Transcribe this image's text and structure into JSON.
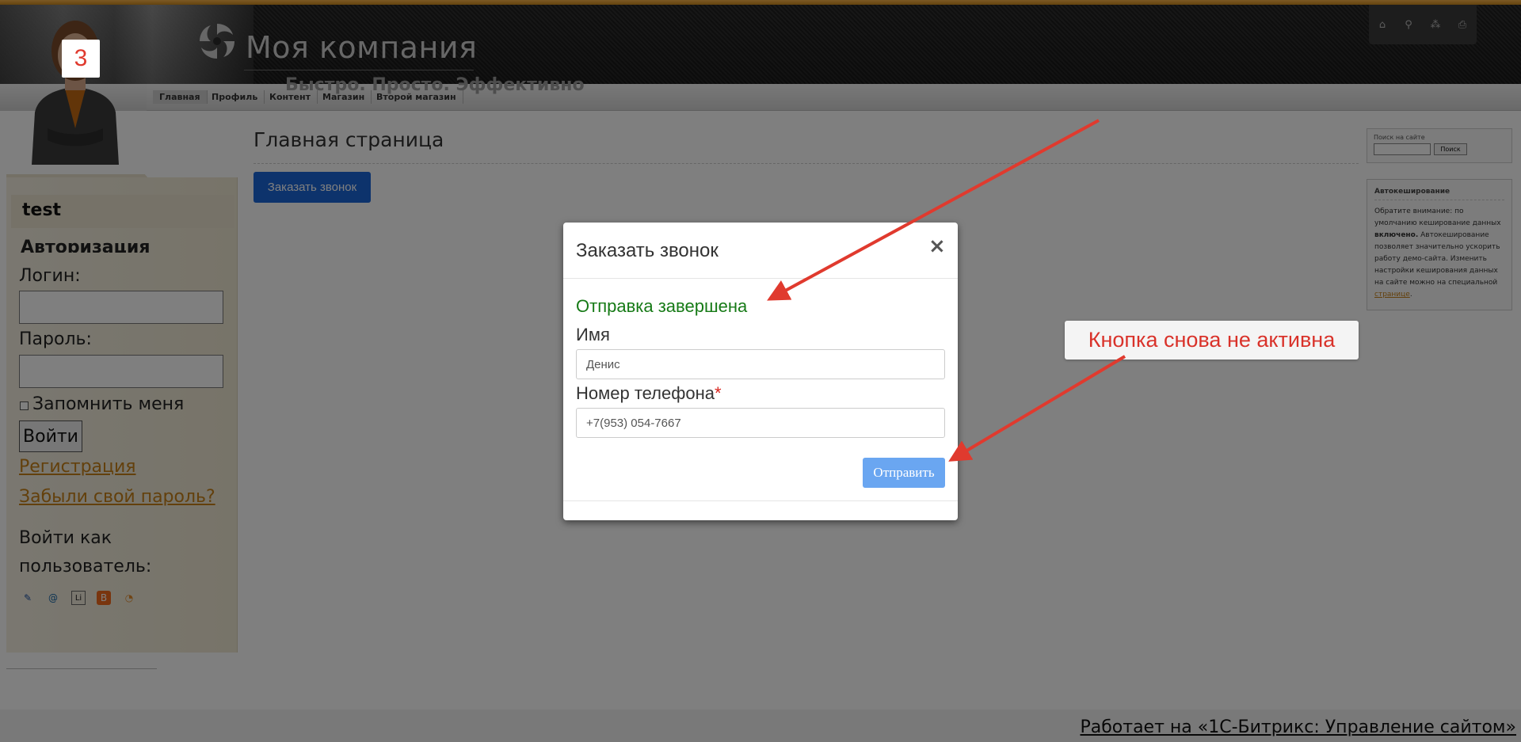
{
  "header": {
    "company_name": "Моя компания",
    "slogan": "Быстро. Просто. Эффективно",
    "icons": [
      "home-icon",
      "search-icon",
      "sitemap-icon",
      "print-icon"
    ]
  },
  "nav": {
    "items": [
      {
        "label": "Главная",
        "active": true
      },
      {
        "label": "Профиль"
      },
      {
        "label": "Контент"
      },
      {
        "label": "Магазин"
      },
      {
        "label": "Второй магазин"
      }
    ]
  },
  "main": {
    "page_title": "Главная страница",
    "order_call_button": "Заказать звонок"
  },
  "sidebar": {
    "test_label": "test",
    "auth_title": "Авторизация",
    "login_label": "Логин:",
    "password_label": "Пароль:",
    "remember_label": "Запомнить меня",
    "login_button": "Войти",
    "register_link": "Регистрация",
    "forgot_link": "Забыли свой пароль?",
    "login_as_label": "Войти как пользователь:",
    "social_icons": [
      "livejournal-icon",
      "mail-ru-icon",
      "liveinternet-icon",
      "blogger-icon",
      "openid-icon"
    ]
  },
  "right": {
    "search_label": "Поиск на сайте",
    "search_button": "Поиск",
    "cache_title": "Автокеширование",
    "cache_text_1": "Обратите внимание: по умолчанию кеширование данных",
    "cache_text_bold": "включено.",
    "cache_text_2": "Автокеширование позволяет значительно ускорить работу демо-сайта. Изменить настройки кеширования данных на сайте можно на специальной",
    "cache_link": "странице",
    "cache_text_end": "."
  },
  "footer": {
    "powered_by": "Работает на «1С-Битрикс: Управление сайтом»"
  },
  "modal": {
    "title": "Заказать звонок",
    "close_glyph": "×",
    "success_message": "Отправка завершена",
    "name_label": "Имя",
    "name_value": "Денис",
    "phone_label": "Номер телефона",
    "phone_required_mark": "*",
    "phone_value": "+7(953) 054-7667",
    "submit_button": "Отправить"
  },
  "annotations": {
    "step_number": "3",
    "callout_text": "Кнопка снова не активна",
    "accent_color": "#e03a2e"
  }
}
